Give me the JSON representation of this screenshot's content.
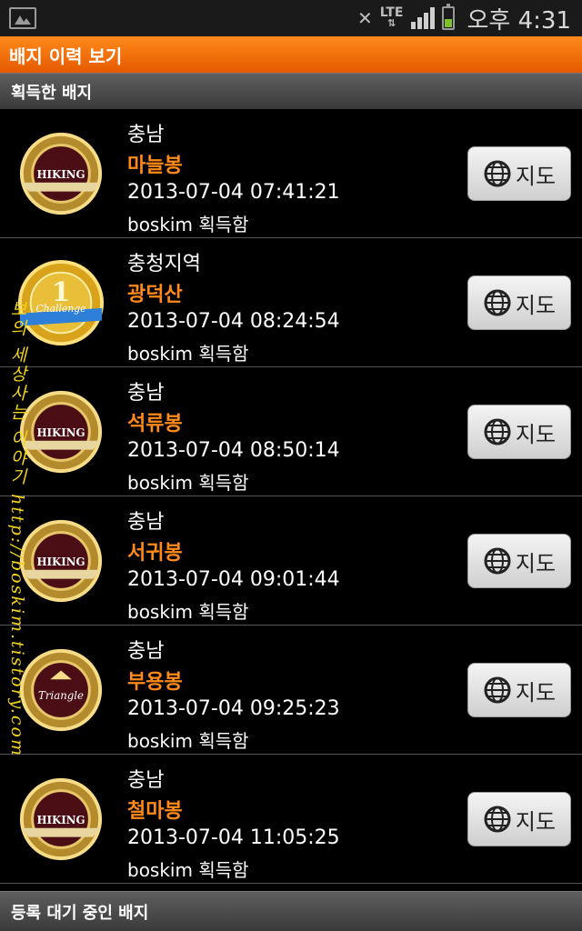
{
  "status_bar": {
    "time": "오후 4:31",
    "network": "LTE"
  },
  "title_bar": {
    "title": "배지 이력 보기"
  },
  "sections": {
    "acquired": "획득한 배지",
    "pending": "등록 대기 중인 배지"
  },
  "badges": [
    {
      "region": "충남",
      "mountain": "마늘봉",
      "datetime": "2013-07-04 07:41:21",
      "user": "boskim 획득함",
      "badge_type": "HIKING",
      "map_label": "지도"
    },
    {
      "region": "충청지역",
      "mountain": "광덕산",
      "datetime": "2013-07-04 08:24:54",
      "user": "boskim 획득함",
      "badge_type": "Challenge",
      "map_label": "지도"
    },
    {
      "region": "충남",
      "mountain": "석류봉",
      "datetime": "2013-07-04 08:50:14",
      "user": "boskim 획득함",
      "badge_type": "HIKING",
      "map_label": "지도"
    },
    {
      "region": "충남",
      "mountain": "서귀봉",
      "datetime": "2013-07-04 09:01:44",
      "user": "boskim 획득함",
      "badge_type": "HIKING",
      "map_label": "지도"
    },
    {
      "region": "충남",
      "mountain": "부용봉",
      "datetime": "2013-07-04 09:25:23",
      "user": "boskim 획득함",
      "badge_type": "Triangle",
      "map_label": "지도"
    },
    {
      "region": "충남",
      "mountain": "철마봉",
      "datetime": "2013-07-04 11:05:25",
      "user": "boskim 획득함",
      "badge_type": "HIKING",
      "map_label": "지도"
    }
  ],
  "watermark": {
    "text": "보의 세상사는 이야기 http://boskim.tistory.com"
  },
  "colors": {
    "accent": "#ff8a1a",
    "title_bar": "#e55a00",
    "watermark": "#f2d31b"
  }
}
